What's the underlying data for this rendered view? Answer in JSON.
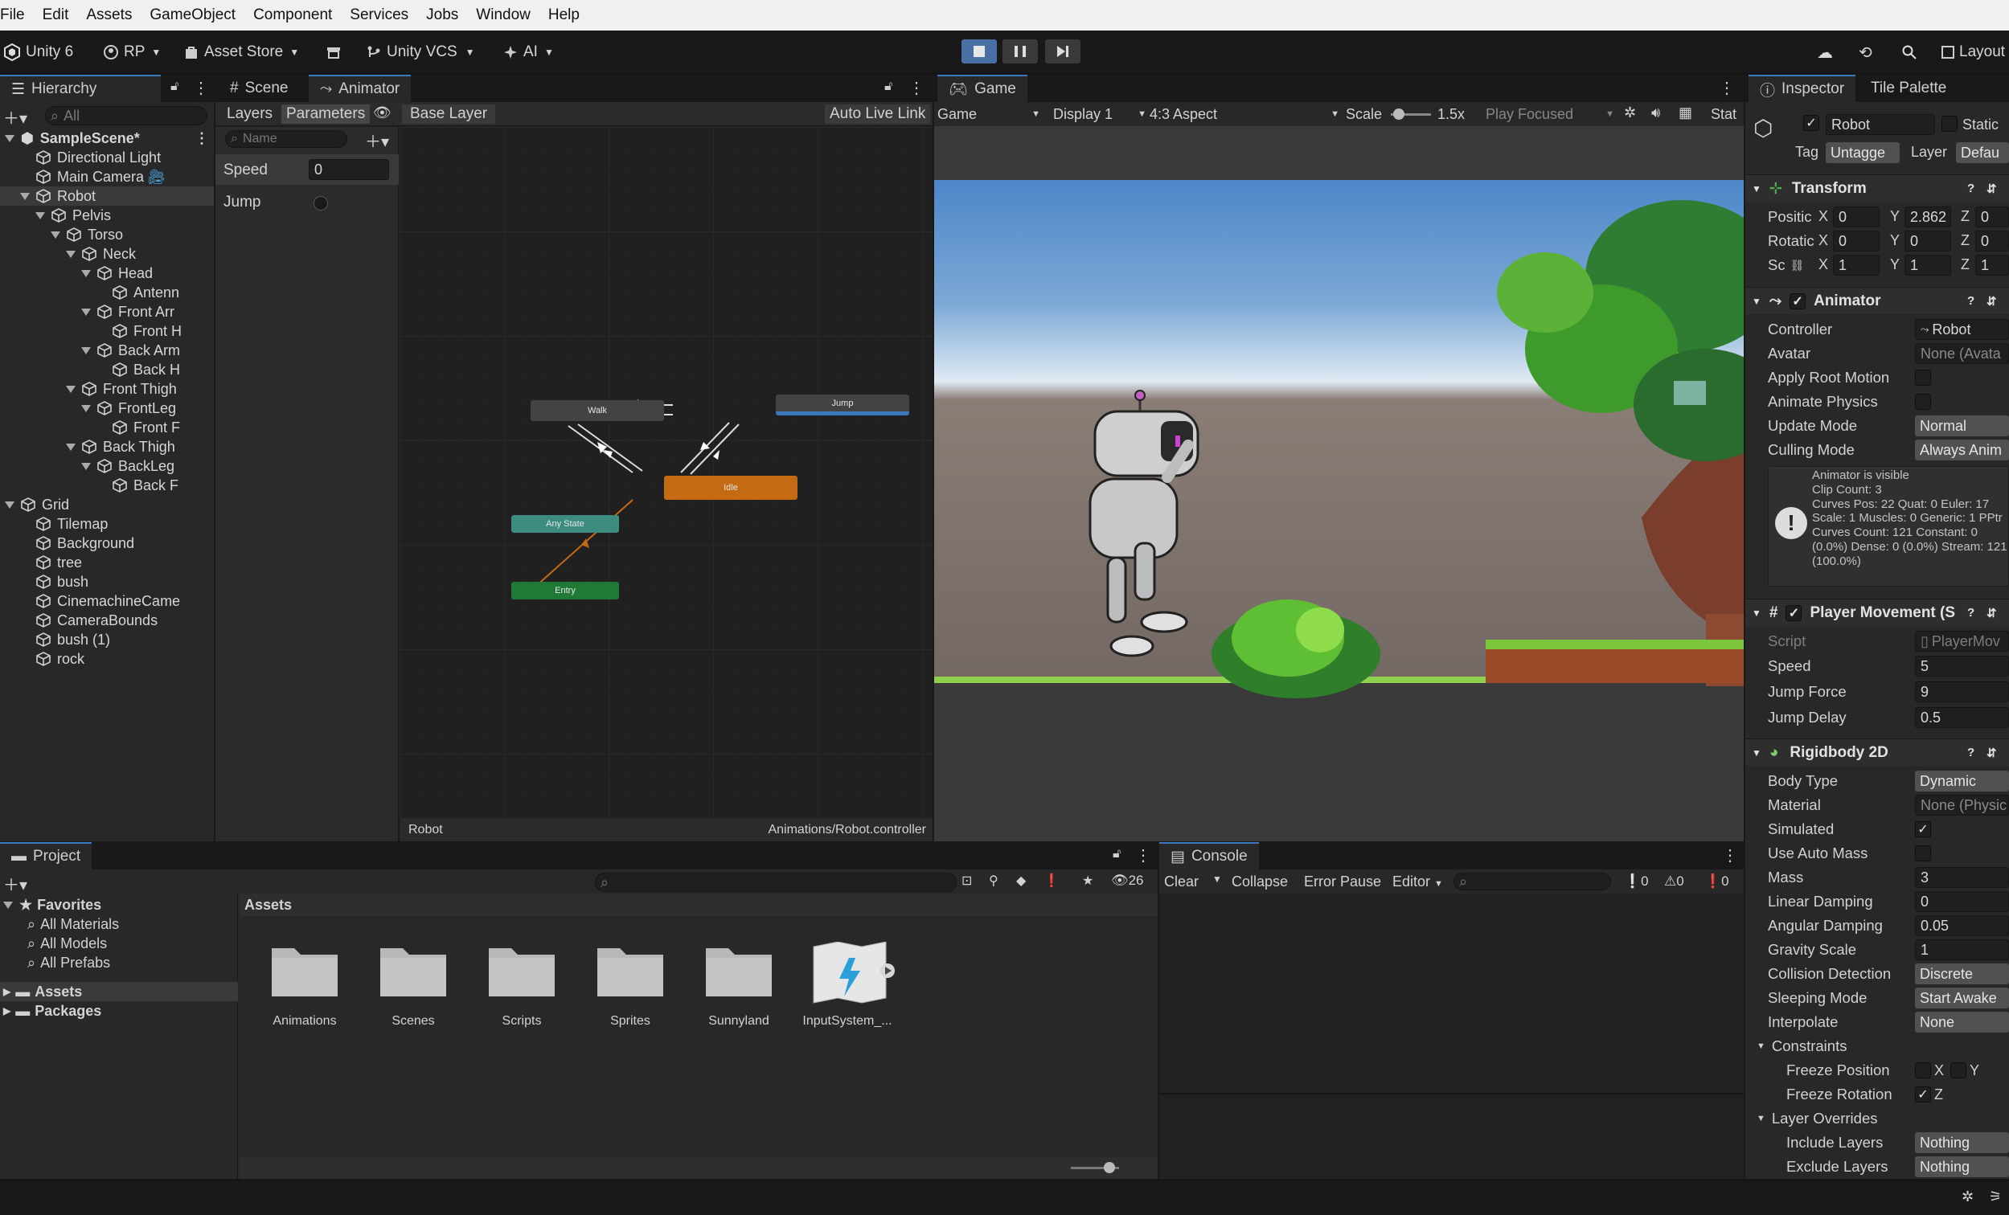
{
  "menu": [
    "File",
    "Edit",
    "Assets",
    "GameObject",
    "Component",
    "Services",
    "Jobs",
    "Window",
    "Help"
  ],
  "toolbar": {
    "unity_label": "Unity 6",
    "account_label": "RP",
    "asset_store_label": "Asset Store",
    "vcs_label": "Unity VCS",
    "ai_label": "AI",
    "layout_label": "Layout"
  },
  "hierarchy": {
    "tab_label": "Hierarchy",
    "search_placeholder": "All",
    "items": [
      {
        "label": "SampleScene*"
      },
      {
        "label": "Directional Light"
      },
      {
        "label": "Main Camera"
      },
      {
        "label": "Robot"
      },
      {
        "label": "Pelvis"
      },
      {
        "label": "Torso"
      },
      {
        "label": "Neck"
      },
      {
        "label": "Head"
      },
      {
        "label": "Antenn"
      },
      {
        "label": "Front Arr"
      },
      {
        "label": "Front H"
      },
      {
        "label": "Back Arm"
      },
      {
        "label": "Back H"
      },
      {
        "label": "Front Thigh"
      },
      {
        "label": "FrontLeg"
      },
      {
        "label": "Front F"
      },
      {
        "label": "Back Thigh"
      },
      {
        "label": "BackLeg"
      },
      {
        "label": "Back F"
      },
      {
        "label": "Grid"
      },
      {
        "label": "Tilemap"
      },
      {
        "label": "Background"
      },
      {
        "label": "tree"
      },
      {
        "label": "bush"
      },
      {
        "label": "CinemachineCame"
      },
      {
        "label": "CameraBounds"
      },
      {
        "label": "bush (1)"
      },
      {
        "label": "rock"
      }
    ]
  },
  "animator": {
    "tab_scene": "Scene",
    "tab_animator": "Animator",
    "layers_label": "Layers",
    "parameters_label": "Parameters",
    "breadcrumb": "Base Layer",
    "auto_live_link": "Auto Live Link",
    "name_placeholder": "Name",
    "params": [
      {
        "name": "Speed",
        "value": "0"
      },
      {
        "name": "Jump",
        "value": ""
      }
    ],
    "states": {
      "walk": "Walk",
      "jump": "Jump",
      "idle": "Idle",
      "any": "Any State",
      "entry": "Entry"
    },
    "footer_left": "Robot",
    "footer_right": "Animations/Robot.controller"
  },
  "game": {
    "tab_label": "Game",
    "mode": "Game",
    "display": "Display 1",
    "aspect": "4:3 Aspect",
    "scale_label": "Scale",
    "scale_value": "1.5x",
    "scale_fraction": 0.2,
    "play_focused": "Play Focused",
    "stats_label": "Stat"
  },
  "inspector": {
    "tab_inspector": "Inspector",
    "tab_tile_palette": "Tile Palette",
    "object_name": "Robot",
    "static_label": "Static",
    "tag_label": "Tag",
    "tag_value": "Untagge",
    "layer_label": "Layer",
    "layer_value": "Defau",
    "transform": {
      "title": "Transform",
      "position_label": "Positic",
      "rotation_label": "Rotatic",
      "scale_label": "Sc",
      "pos": [
        "0",
        "2.862",
        "0"
      ],
      "rot": [
        "0",
        "0",
        "0"
      ],
      "scl": [
        "1",
        "1",
        "1"
      ]
    },
    "animator": {
      "title": "Animator",
      "controller_label": "Controller",
      "controller_value": "Robot",
      "avatar_label": "Avatar",
      "avatar_value": "None (Avata",
      "apply_root_label": "Apply Root Motion",
      "animate_physics_label": "Animate Physics",
      "update_mode_label": "Update Mode",
      "update_mode_value": "Normal",
      "culling_label": "Culling Mode",
      "culling_value": "Always Anim",
      "info_lines": [
        "Animator is visible",
        "Clip Count: 3",
        "Curves Pos: 22 Quat: 0 Euler: 17",
        "Scale: 1 Muscles: 0 Generic: 1 PPtr",
        "Curves Count: 121 Constant: 0",
        "(0.0%) Dense: 0 (0.0%) Stream: 121",
        "(100.0%)"
      ]
    },
    "player_movement": {
      "title": "Player Movement (S",
      "script_label": "Script",
      "script_value": "PlayerMov",
      "speed_label": "Speed",
      "speed_value": "5",
      "jump_force_label": "Jump Force",
      "jump_force_value": "9",
      "jump_delay_label": "Jump Delay",
      "jump_delay_value": "0.5"
    },
    "rigidbody": {
      "title": "Rigidbody 2D",
      "body_type_label": "Body Type",
      "body_type_value": "Dynamic",
      "material_label": "Material",
      "material_value": "None (Physic",
      "simulated_label": "Simulated",
      "use_auto_mass_label": "Use Auto Mass",
      "mass_label": "Mass",
      "mass_value": "3",
      "linear_damping_label": "Linear Damping",
      "linear_damping_value": "0",
      "angular_damping_label": "Angular Damping",
      "angular_damping_value": "0.05",
      "gravity_label": "Gravity Scale",
      "gravity_value": "1",
      "collision_label": "Collision Detection",
      "collision_value": "Discrete",
      "sleeping_label": "Sleeping Mode",
      "sleeping_value": "Start Awake",
      "interpolate_label": "Interpolate",
      "interpolate_value": "None",
      "constraints_label": "Constraints",
      "freeze_pos_label": "Freeze Position",
      "freeze_rot_label": "Freeze Rotation",
      "x_label": "X",
      "y_label": "Y",
      "z_label": "Z",
      "layer_overrides_label": "Layer Overrides",
      "include_label": "Include Layers",
      "include_value": "Nothing",
      "exclude_label": "Exclude Layers",
      "exclude_value": "Nothing"
    }
  },
  "project": {
    "tab_label": "Project",
    "favorites_label": "Favorites",
    "favorites": [
      "All Materials",
      "All Models",
      "All Prefabs"
    ],
    "roots": [
      "Assets",
      "Packages"
    ],
    "breadcrumb": "Assets",
    "hidden_count": "26",
    "zoom_fraction": 0.8,
    "assets": [
      "Animations",
      "Scenes",
      "Scripts",
      "Sprites",
      "Sunnyland",
      "InputSystem_..."
    ]
  },
  "console": {
    "tab_label": "Console",
    "clear": "Clear",
    "collapse": "Collapse",
    "error_pause": "Error Pause",
    "editor": "Editor",
    "counts": [
      "0",
      "0",
      "0"
    ]
  },
  "colors": {
    "accent": "#3a79bb",
    "idle_state": "#c46a12",
    "entry_state": "#1f7a35",
    "any_state": "#3c8c80",
    "sky_top": "#4d86c8",
    "ground": "#6a605c"
  }
}
